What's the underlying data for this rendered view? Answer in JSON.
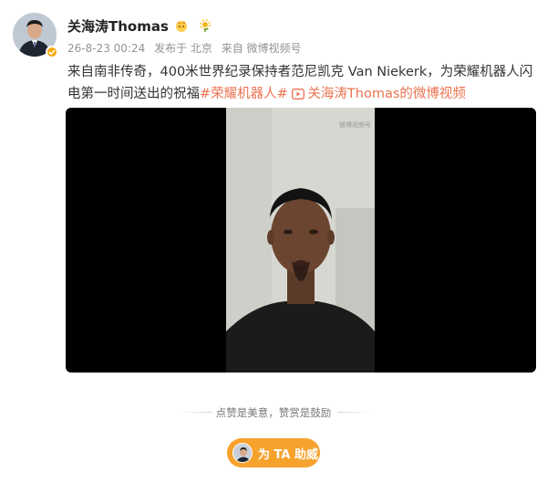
{
  "post": {
    "username": "关海涛Thomas",
    "meta": {
      "time": "26-8-23 00:24",
      "source": "发布于 北京",
      "via": "来自 微博视频号"
    },
    "text_main": "来自南非传奇，400米世界纪录保持者范尼凯克 Van Niekerk，为荣耀机器人闪电第一时间送出的祝福",
    "hashtag": "#荣耀机器人#",
    "video_link": "关海涛Thomas的微博视频",
    "video_watermark": "微博视频号"
  },
  "footer": {
    "reward_note": "点赞是美意，赞赏是鼓励",
    "support_button": "为 TA 助威"
  },
  "icons": {
    "verified": "verified-badge-icon",
    "name_badge": "crown-badge-icon",
    "name_flair": "sun-flower-icon",
    "video_link": "play-video-icon"
  },
  "colors": {
    "link": "#eb7350",
    "support_button": "#f6a22d",
    "verified": "#f7a600"
  }
}
